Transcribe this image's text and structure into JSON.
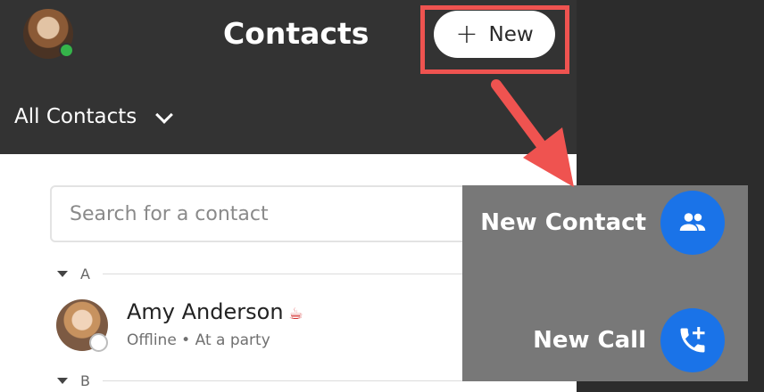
{
  "header": {
    "title": "Contacts",
    "new_button": {
      "icon": "plus-icon",
      "label": "New"
    }
  },
  "filter": {
    "label": "All Contacts",
    "icon": "chevron-down-icon"
  },
  "search": {
    "placeholder": "Search for a contact",
    "value": ""
  },
  "sections": [
    {
      "letter": "A",
      "contacts": [
        {
          "name": "Amy Anderson",
          "mood_icon": "fondue-pot-icon",
          "presence": "Offline",
          "status_text": "Offline • At a party"
        }
      ]
    },
    {
      "letter": "B",
      "contacts": []
    }
  ],
  "new_menu": {
    "items": [
      {
        "label": "New Contact",
        "icon": "people-icon"
      },
      {
        "label": "New Call",
        "icon": "phone-add-icon"
      }
    ]
  },
  "colors": {
    "header_bg": "#333333",
    "list_bg": "#ffffff",
    "accent_blue": "#1a73e8",
    "presence_online": "#35b44a",
    "highlight_red": "#ef5350",
    "menu_bg": "#787878"
  }
}
